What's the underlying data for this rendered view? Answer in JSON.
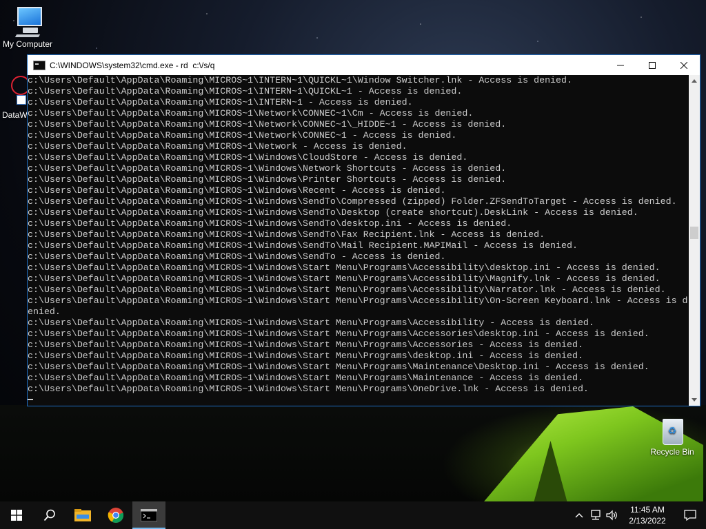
{
  "desktop": {
    "icons": [
      {
        "label": "My Computer"
      },
      {
        "label": "DataW"
      },
      {
        "label": "Recycle Bin"
      }
    ]
  },
  "window": {
    "title": "C:\\WINDOWS\\system32\\cmd.exe - rd  c:\\/s/q",
    "minimize": "—",
    "maximize": "☐",
    "close": "✕"
  },
  "console": {
    "lines": [
      "c:\\Users\\Default\\AppData\\Roaming\\MICROS~1\\INTERN~1\\QUICKL~1\\Window Switcher.lnk - Access is denied.",
      "c:\\Users\\Default\\AppData\\Roaming\\MICROS~1\\INTERN~1\\QUICKL~1 - Access is denied.",
      "c:\\Users\\Default\\AppData\\Roaming\\MICROS~1\\INTERN~1 - Access is denied.",
      "c:\\Users\\Default\\AppData\\Roaming\\MICROS~1\\Network\\CONNEC~1\\Cm - Access is denied.",
      "c:\\Users\\Default\\AppData\\Roaming\\MICROS~1\\Network\\CONNEC~1\\_HIDDE~1 - Access is denied.",
      "c:\\Users\\Default\\AppData\\Roaming\\MICROS~1\\Network\\CONNEC~1 - Access is denied.",
      "c:\\Users\\Default\\AppData\\Roaming\\MICROS~1\\Network - Access is denied.",
      "c:\\Users\\Default\\AppData\\Roaming\\MICROS~1\\Windows\\CloudStore - Access is denied.",
      "c:\\Users\\Default\\AppData\\Roaming\\MICROS~1\\Windows\\Network Shortcuts - Access is denied.",
      "c:\\Users\\Default\\AppData\\Roaming\\MICROS~1\\Windows\\Printer Shortcuts - Access is denied.",
      "c:\\Users\\Default\\AppData\\Roaming\\MICROS~1\\Windows\\Recent - Access is denied.",
      "c:\\Users\\Default\\AppData\\Roaming\\MICROS~1\\Windows\\SendTo\\Compressed (zipped) Folder.ZFSendToTarget - Access is denied.",
      "c:\\Users\\Default\\AppData\\Roaming\\MICROS~1\\Windows\\SendTo\\Desktop (create shortcut).DeskLink - Access is denied.",
      "c:\\Users\\Default\\AppData\\Roaming\\MICROS~1\\Windows\\SendTo\\desktop.ini - Access is denied.",
      "c:\\Users\\Default\\AppData\\Roaming\\MICROS~1\\Windows\\SendTo\\Fax Recipient.lnk - Access is denied.",
      "c:\\Users\\Default\\AppData\\Roaming\\MICROS~1\\Windows\\SendTo\\Mail Recipient.MAPIMail - Access is denied.",
      "c:\\Users\\Default\\AppData\\Roaming\\MICROS~1\\Windows\\SendTo - Access is denied.",
      "c:\\Users\\Default\\AppData\\Roaming\\MICROS~1\\Windows\\Start Menu\\Programs\\Accessibility\\desktop.ini - Access is denied.",
      "c:\\Users\\Default\\AppData\\Roaming\\MICROS~1\\Windows\\Start Menu\\Programs\\Accessibility\\Magnify.lnk - Access is denied.",
      "c:\\Users\\Default\\AppData\\Roaming\\MICROS~1\\Windows\\Start Menu\\Programs\\Accessibility\\Narrator.lnk - Access is denied.",
      "c:\\Users\\Default\\AppData\\Roaming\\MICROS~1\\Windows\\Start Menu\\Programs\\Accessibility\\On-Screen Keyboard.lnk - Access is d",
      "enied.",
      "c:\\Users\\Default\\AppData\\Roaming\\MICROS~1\\Windows\\Start Menu\\Programs\\Accessibility - Access is denied.",
      "c:\\Users\\Default\\AppData\\Roaming\\MICROS~1\\Windows\\Start Menu\\Programs\\Accessories\\desktop.ini - Access is denied.",
      "c:\\Users\\Default\\AppData\\Roaming\\MICROS~1\\Windows\\Start Menu\\Programs\\Accessories - Access is denied.",
      "c:\\Users\\Default\\AppData\\Roaming\\MICROS~1\\Windows\\Start Menu\\Programs\\desktop.ini - Access is denied.",
      "c:\\Users\\Default\\AppData\\Roaming\\MICROS~1\\Windows\\Start Menu\\Programs\\Maintenance\\Desktop.ini - Access is denied.",
      "c:\\Users\\Default\\AppData\\Roaming\\MICROS~1\\Windows\\Start Menu\\Programs\\Maintenance - Access is denied.",
      "c:\\Users\\Default\\AppData\\Roaming\\MICROS~1\\Windows\\Start Menu\\Programs\\OneDrive.lnk - Access is denied."
    ]
  },
  "taskbar": {
    "apps": [
      {
        "icon": "windows-start-icon"
      },
      {
        "icon": "search-icon"
      },
      {
        "icon": "file-explorer-icon"
      },
      {
        "icon": "chrome-icon"
      },
      {
        "icon": "command-prompt-icon",
        "active": true
      }
    ],
    "tray_icons": [
      "chevron-up-icon",
      "network-icon",
      "volume-icon"
    ],
    "time": "11:45 AM",
    "date": "2/13/2022"
  },
  "colors": {
    "console_bg": "#0c0c0c",
    "console_text": "#cccccc",
    "taskbar_bg": "#101010",
    "window_accent": "#1f6fc5"
  }
}
